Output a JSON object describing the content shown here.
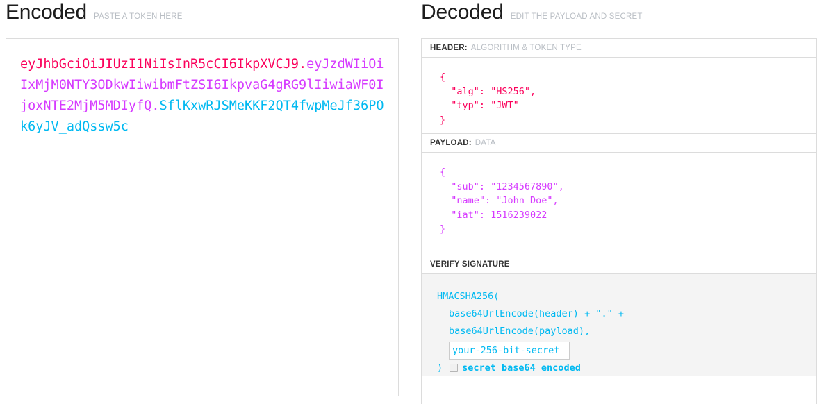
{
  "encoded": {
    "title": "Encoded",
    "subtitle": "PASTE A TOKEN HERE",
    "token": {
      "header_part": "eyJhbGciOiJIUzI1NiIsInR5cCI6IkpXVCJ9",
      "dot1": ".",
      "payload_part": "eyJzdWIiOiIxMjM0NTY3ODkwIiwibmFtZSI6IkpvaG4gRG9lIiwiaWF0IjoxNTE2MjM5MDIyfQ",
      "dot2": ".",
      "signature_part": "SflKxwRJSMeKKF2QT4fwpMeJf36POk6yJV_adQssw5c"
    }
  },
  "decoded": {
    "title": "Decoded",
    "subtitle": "EDIT THE PAYLOAD AND SECRET",
    "sections": {
      "header": {
        "label": "HEADER:",
        "hint": "ALGORITHM & TOKEN TYPE",
        "code": "{\n  \"alg\": \"HS256\",\n  \"typ\": \"JWT\"\n}"
      },
      "payload": {
        "label": "PAYLOAD:",
        "hint": "DATA",
        "code": "{\n  \"sub\": \"1234567890\",\n  \"name\": \"John Doe\",\n  \"iat\": 1516239022\n}"
      },
      "signature": {
        "label": "VERIFY SIGNATURE",
        "hint": "",
        "line1": "HMACSHA256(",
        "line2": "base64UrlEncode(header) + \".\" +",
        "line3": "base64UrlEncode(payload),",
        "secret_value": "your-256-bit-secret",
        "secret_placeholder": "your-256-bit-secret",
        "closing_paren": ")",
        "checkbox_label": "secret base64 encoded",
        "checkbox_checked": false
      }
    }
  },
  "colors": {
    "header_token": "#fb015b",
    "payload_token": "#d63aff",
    "signature_token": "#00b9f1",
    "panel_border": "#dcdcdc",
    "muted_text": "#b9bec4",
    "sig_background": "#f4f4f4"
  }
}
